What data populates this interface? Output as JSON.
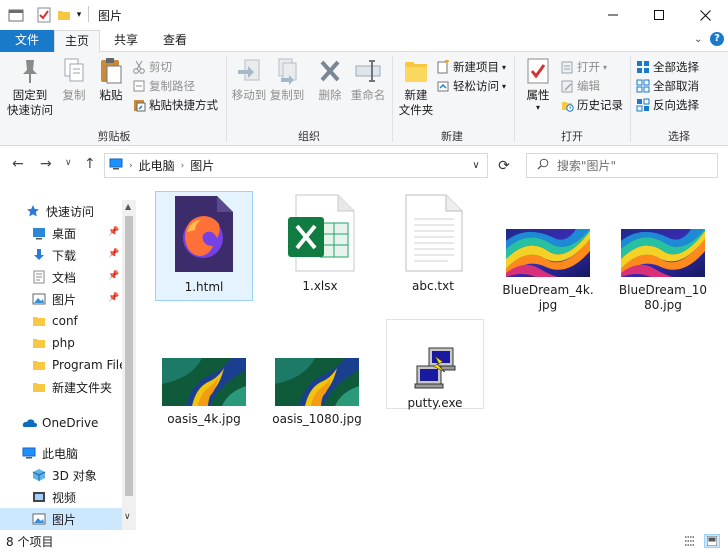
{
  "window": {
    "title": "图片",
    "controls": [
      "minimize",
      "maximize",
      "close"
    ]
  },
  "ribbon_tabs": [
    {
      "label": "文件"
    },
    {
      "label": "主页"
    },
    {
      "label": "共享"
    },
    {
      "label": "查看"
    }
  ],
  "ribbon": {
    "clipboard": {
      "label": "剪贴板",
      "pin": "固定到\n快速访问",
      "copy": "复制",
      "paste": "粘贴",
      "cut": "剪切",
      "copy_path": "复制路径",
      "paste_shortcut": "粘贴快捷方式"
    },
    "organize": {
      "label": "组织",
      "move_to": "移动到",
      "copy_to": "复制到",
      "delete": "删除",
      "rename": "重命名"
    },
    "new": {
      "label": "新建",
      "new_folder": "新建\n文件夹",
      "new_item": "新建项目",
      "easy_access": "轻松访问"
    },
    "open": {
      "label": "打开",
      "properties": "属性",
      "open": "打开",
      "edit": "编辑",
      "history": "历史记录"
    },
    "select": {
      "label": "选择",
      "select_all": "全部选择",
      "select_none": "全部取消",
      "invert": "反向选择"
    }
  },
  "address": {
    "path": [
      "此电脑",
      "图片"
    ],
    "search_placeholder": "搜索\"图片\""
  },
  "nav_pane": {
    "quick_access": "快速访问",
    "items": [
      {
        "label": "桌面",
        "pinned": true
      },
      {
        "label": "下载",
        "pinned": true
      },
      {
        "label": "文档",
        "pinned": true
      },
      {
        "label": "图片",
        "pinned": true
      },
      {
        "label": "conf",
        "pinned": false
      },
      {
        "label": "php",
        "pinned": false
      },
      {
        "label": "Program Files",
        "pinned": false
      },
      {
        "label": "新建文件夹",
        "pinned": false
      }
    ],
    "onedrive": "OneDrive",
    "this_pc": "此电脑",
    "pc_items": [
      {
        "label": "3D 对象"
      },
      {
        "label": "视频"
      },
      {
        "label": "图片"
      }
    ]
  },
  "files": [
    {
      "name": "1.html",
      "type": "firefox-html"
    },
    {
      "name": "1.xlsx",
      "type": "excel"
    },
    {
      "name": "abc.txt",
      "type": "text"
    },
    {
      "name": "BlueDream_4k.jpg",
      "type": "image-bluedream"
    },
    {
      "name": "BlueDream_1080.jpg",
      "type": "image-bluedream"
    },
    {
      "name": "oasis_4k.jpg",
      "type": "image-oasis"
    },
    {
      "name": "oasis_1080.jpg",
      "type": "image-oasis"
    },
    {
      "name": "putty.exe",
      "type": "putty"
    }
  ],
  "status": {
    "item_count": "8 个项目"
  },
  "colors": {
    "file_tab": "#1979ca",
    "selection": "#cce8ff",
    "selection_border": "#99d1ff"
  }
}
